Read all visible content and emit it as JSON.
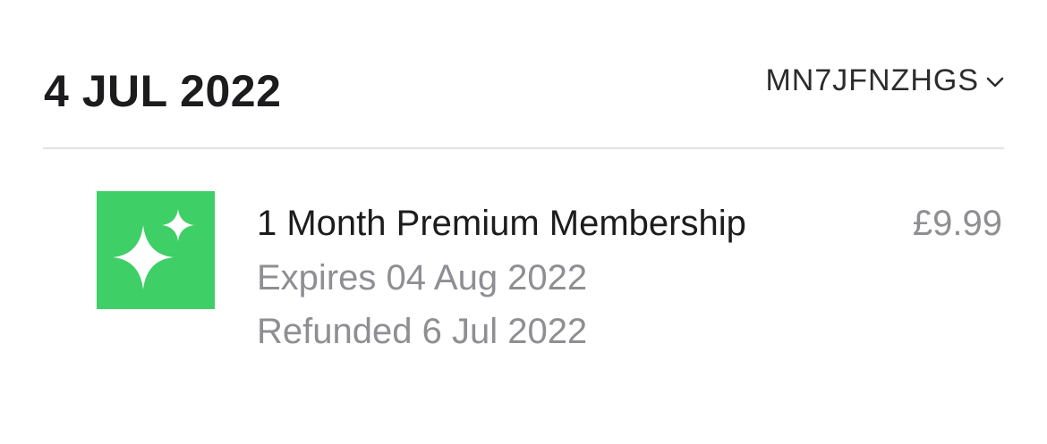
{
  "header": {
    "date": "4 JUL 2022",
    "order_id": "MN7JFNZHGS",
    "order_chevron_icon": "chevron-down-icon"
  },
  "purchase": {
    "icon": "sparkles-icon",
    "icon_color": "#3ecf66",
    "title": "1 Month Premium Membership",
    "price": "£9.99",
    "expires": "Expires 04 Aug 2022",
    "refunded": "Refunded 6 Jul 2022"
  },
  "colors": {
    "primary_text": "#1c1c1e",
    "secondary_text": "#8e8e93",
    "divider": "#e3e3e6"
  }
}
